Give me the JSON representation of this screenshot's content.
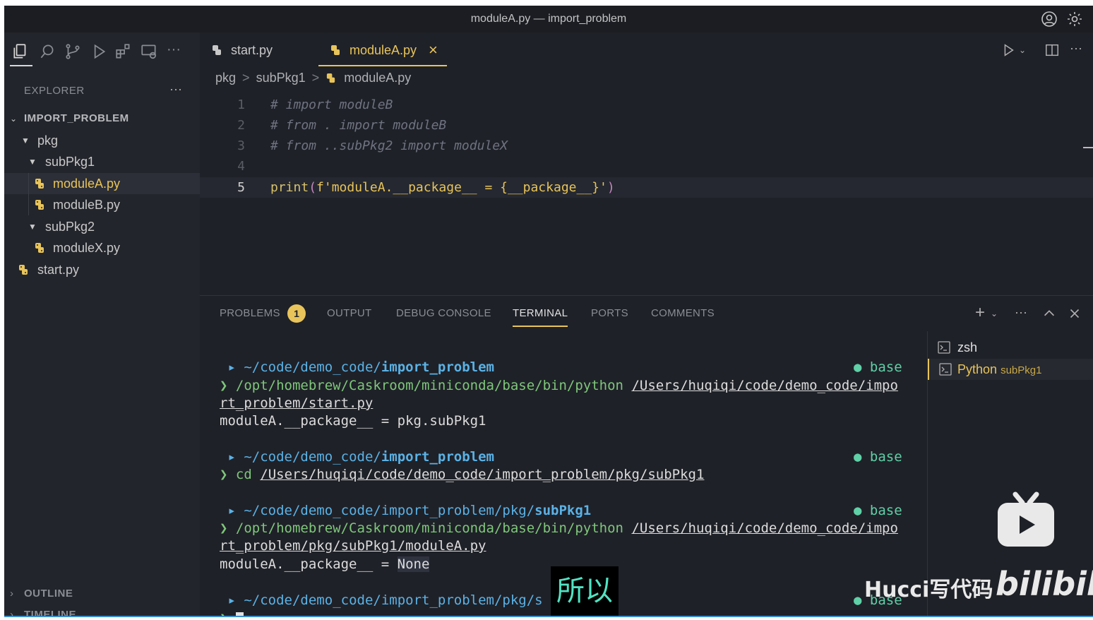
{
  "window": {
    "title": "moduleA.py — import_problem"
  },
  "sidebar": {
    "explorer_label": "EXPLORER",
    "more": "···",
    "root_label": "IMPORT_PROBLEM",
    "tree": [
      {
        "label": "pkg"
      },
      {
        "label": "subPkg1"
      },
      {
        "label": "moduleA.py"
      },
      {
        "label": "moduleB.py"
      },
      {
        "label": "subPkg2"
      },
      {
        "label": "moduleX.py"
      },
      {
        "label": "start.py"
      }
    ],
    "outline_label": "OUTLINE",
    "timeline_label": "TIMELINE"
  },
  "editor": {
    "tabs": [
      {
        "label": "start.py"
      },
      {
        "label": "moduleA.py",
        "close": "×"
      }
    ],
    "breadcrumb": {
      "part1": "pkg",
      "part2": "subPkg1",
      "part3": "moduleA.py",
      "sep": ">"
    },
    "lines": [
      {
        "num": "1",
        "text": "# import moduleB"
      },
      {
        "num": "2",
        "text": "# from . import moduleB"
      },
      {
        "num": "3",
        "text": "# from ..subPkg2 import moduleX"
      },
      {
        "num": "4",
        "text": ""
      },
      {
        "num": "5",
        "fn": "print",
        "open": "(",
        "str": "f'moduleA.__package__ = {__package__}'",
        "close": ")"
      }
    ]
  },
  "panel": {
    "tabs": {
      "problems": "PROBLEMS",
      "problems_count": "1",
      "output": "OUTPUT",
      "debug": "DEBUG CONSOLE",
      "terminal": "TERMINAL",
      "ports": "PORTS",
      "comments": "COMMENTS"
    },
    "terminal": {
      "apple": "",
      "folder": "▸",
      "arrow": "❯",
      "base": "base",
      "b1_path": "~/code/demo_code/",
      "b1_dir": "import_problem",
      "b1_cmd_prog": "/opt/homebrew/Caskroom/miniconda/base/bin/python",
      "b1_cmd_arg_a": "/Users/huqiqi/code/demo_code/impo",
      "b1_cmd_arg_b": "rt_problem/start.py",
      "b1_out": "moduleA.__package__ = pkg.subPkg1",
      "b2_path": "~/code/demo_code/",
      "b2_dir": "import_problem",
      "b2_cmd": "cd",
      "b2_arg": "/Users/huqiqi/code/demo_code/import_problem/pkg/subPkg1",
      "b3_path": "~/code/demo_code/import_problem/pkg/",
      "b3_dir": "subPkg1",
      "b3_cmd_prog": "/opt/homebrew/Caskroom/miniconda/base/bin/python",
      "b3_cmd_arg_a": "/Users/huqiqi/code/demo_code/impo",
      "b3_cmd_arg_b": "rt_problem/pkg/subPkg1/moduleA.py",
      "b3_out_a": "moduleA.__package__ = ",
      "b3_out_b": "None",
      "b4_path": "~/code/demo_code/import_problem/pkg/s"
    },
    "terminal_list": [
      {
        "label": "zsh"
      },
      {
        "label": "Python",
        "sub": "subPkg1"
      }
    ]
  },
  "overlay": {
    "subtitle": "所以",
    "watermark_text": "Hucci写代码",
    "watermark_logo": "bilibili"
  },
  "colors": {
    "accent": "#e8c45a",
    "terminal_path": "#5ab2e6",
    "conda": "#5fd0a7"
  }
}
